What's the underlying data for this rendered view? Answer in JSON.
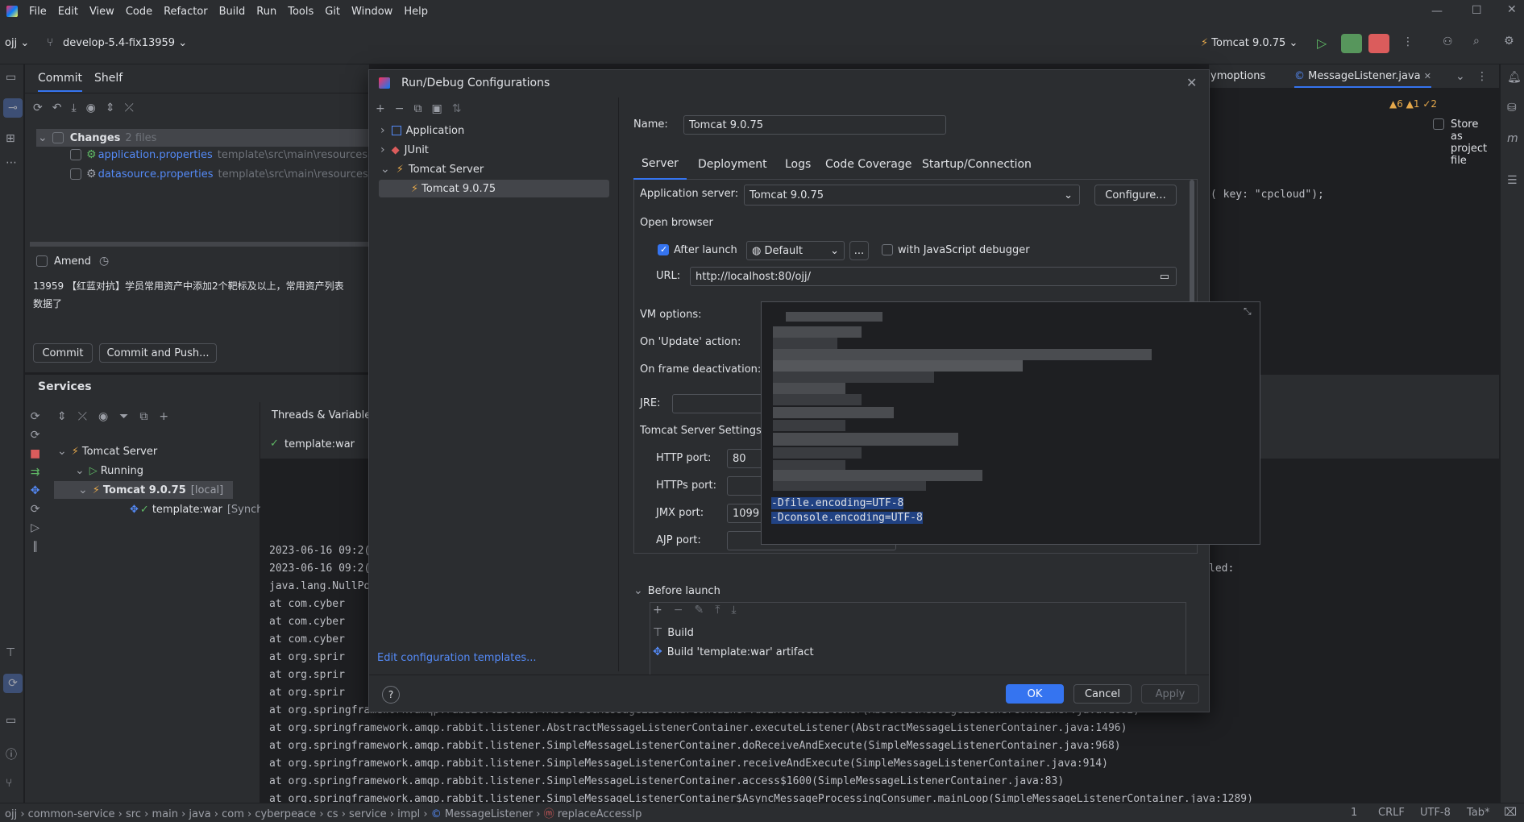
{
  "menu": [
    "File",
    "Edit",
    "View",
    "Code",
    "Refactor",
    "Build",
    "Run",
    "Tools",
    "Git",
    "Window",
    "Help"
  ],
  "toolbar": {
    "project": "ojj",
    "branch": "develop-5.4-fix13959",
    "run_config": "Tomcat 9.0.75"
  },
  "commit_panel": {
    "tabs": [
      "Commit",
      "Shelf"
    ],
    "changes_label": "Changes",
    "changes_count": "2 files",
    "files": [
      {
        "name": "application.properties",
        "path": "template\\src\\main\\resources"
      },
      {
        "name": "datasource.properties",
        "path": "template\\src\\main\\resources\\c"
      }
    ],
    "amend": "Amend",
    "message_line1": "13959 【红蓝对抗】学员常用资产中添加2个靶标及以上，常用资产列表",
    "message_line2": "数据了",
    "commit_btn": "Commit",
    "commit_push_btn": "Commit and Push..."
  },
  "services": {
    "title": "Services",
    "threads_tab": "Threads & Variables",
    "tree": {
      "server": "Tomcat Server",
      "running": "Running",
      "instance": "Tomcat 9.0.75",
      "instance_suffix": "[local]",
      "artifact": "template:war",
      "artifact_suffix": "[Synch"
    },
    "artifact_status": "template:war"
  },
  "console": [
    "2023-06-16 09:2(",
    "2023-06-16 09:2(",
    "java.lang.NullPo",
    "    at com.cyber",
    "    at com.cyber",
    "    at com.cyber",
    "    at org.sprir",
    "    at org.sprir",
    "    at org.sprir",
    "    at org.springframework.amqp.rabbit.listener.AbstractMessageListenerContainer.doExecuteListener(AbstractMessageListenerContainer.java:1602)",
    "    at org.springframework.amqp.rabbit.listener.AbstractMessageListenerContainer.executeListener(AbstractMessageListenerContainer.java:1496)",
    "    at org.springframework.amqp.rabbit.listener.SimpleMessageListenerContainer.doReceiveAndExecute(SimpleMessageListenerContainer.java:968)",
    "    at org.springframework.amqp.rabbit.listener.SimpleMessageListenerContainer.receiveAndExecute(SimpleMessageListenerContainer.java:914)",
    "    at org.springframework.amqp.rabbit.listener.SimpleMessageListenerContainer.access$1600(SimpleMessageListenerContainer.java:83)",
    "    at org.springframework.amqp.rabbit.listener.SimpleMessageListenerContainer$AsyncMessageProcessingConsumer.mainLoop(SimpleMessageListenerContainer.java:1289)"
  ],
  "editor": {
    "tabs": [
      "ymoptions",
      "MessageListener.java"
    ],
    "inspections": "▲6  ▲1  ✓2",
    "code_line": "( key: \"cpcloud\");",
    "console_right": "led:"
  },
  "dialog": {
    "title": "Run/Debug Configurations",
    "tree": [
      "Application",
      "JUnit",
      "Tomcat Server",
      "Tomcat 9.0.75"
    ],
    "edit_templates": "Edit configuration templates...",
    "name_label": "Name:",
    "name_value": "Tomcat 9.0.75",
    "store_label": "Store as project file",
    "tabs": [
      "Server",
      "Deployment",
      "Logs",
      "Code Coverage",
      "Startup/Connection"
    ],
    "app_server_label": "Application server:",
    "app_server_value": "Tomcat 9.0.75",
    "configure_btn": "Configure...",
    "open_browser": "Open browser",
    "after_launch": "After launch",
    "browser": "Default",
    "ellipsis": "...",
    "js_debugger": "with JavaScript debugger",
    "url_label": "URL:",
    "url_value": "http://localhost:80/ojj/",
    "vm_options": "VM options:",
    "on_update": "On 'Update' action:",
    "on_frame": "On frame deactivation:",
    "jre": "JRE:",
    "tomcat_settings": "Tomcat Server Settings",
    "http_port_label": "HTTP port:",
    "http_port": "80",
    "https_port_label": "HTTPs port:",
    "jmx_port_label": "JMX port:",
    "jmx_port": "1099",
    "ajp_port_label": "AJP port:",
    "before_launch": "Before launch",
    "tasks": [
      "Build",
      "Build 'template:war' artifact"
    ],
    "vm_popup_lines": [
      "-Dfile.encoding=UTF-8",
      "-Dconsole.encoding=UTF-8"
    ],
    "ok": "OK",
    "cancel": "Cancel",
    "apply": "Apply",
    "help": "?"
  },
  "statusbar": {
    "crumbs": [
      "ojj",
      "common-service",
      "src",
      "main",
      "java",
      "com",
      "cyberpeace",
      "cs",
      "service",
      "impl",
      "MessageListener",
      "replaceAccessIp"
    ],
    "position": "1",
    "line_sep": "CRLF",
    "encoding": "UTF-8",
    "indent": "Tab*"
  }
}
